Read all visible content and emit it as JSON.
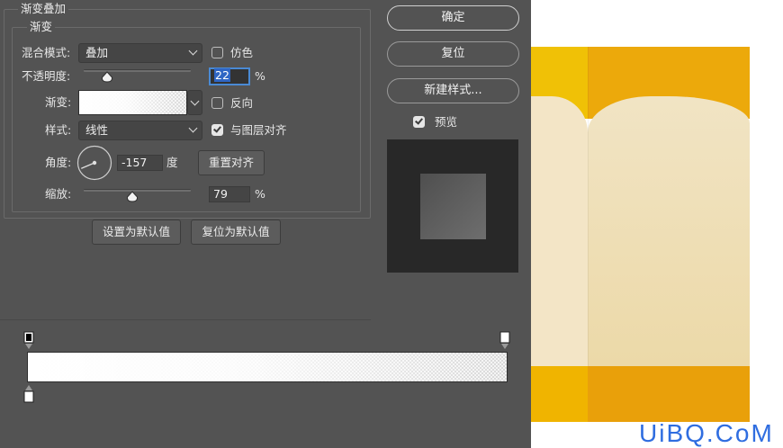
{
  "dialog": {
    "section_title": "渐变叠加",
    "subsection_title": "渐变",
    "blend_mode": {
      "label": "混合模式:",
      "value": "叠加"
    },
    "dither": {
      "label": "仿色",
      "checked": false
    },
    "opacity": {
      "label": "不透明度:",
      "value": "22",
      "unit": "%",
      "level_percent": 22
    },
    "gradient": {
      "label": "渐变:",
      "reverse_label": "反向",
      "reverse_checked": false
    },
    "style": {
      "label": "样式:",
      "value": "线性",
      "align_label": "与图层对齐",
      "align_checked": true
    },
    "angle": {
      "label": "角度:",
      "value": "-157",
      "unit": "度",
      "degrees": -157
    },
    "reset_alignment": "重置对齐",
    "scale": {
      "label": "缩放:",
      "value": "79",
      "unit": "%",
      "level_percent": 79
    },
    "set_default": "设置为默认值",
    "reset_default": "复位为默认值"
  },
  "actions": {
    "ok": "确定",
    "reset": "复位",
    "new_style": "新建样式...",
    "preview_label": "预览",
    "preview_checked": true
  },
  "gradient_editor": {
    "opacity_stops": [
      "black",
      "white"
    ],
    "color_stops": [
      "white"
    ]
  },
  "watermark": "UiBQ.CoM",
  "colors": {
    "panel_bg": "#535353",
    "accent_blue": "#4a8ad4",
    "art_yellow": "#f0c106",
    "art_orange": "#eca90b",
    "art_cream": "#f1e4c4",
    "watermark_blue": "#2f6de0"
  }
}
